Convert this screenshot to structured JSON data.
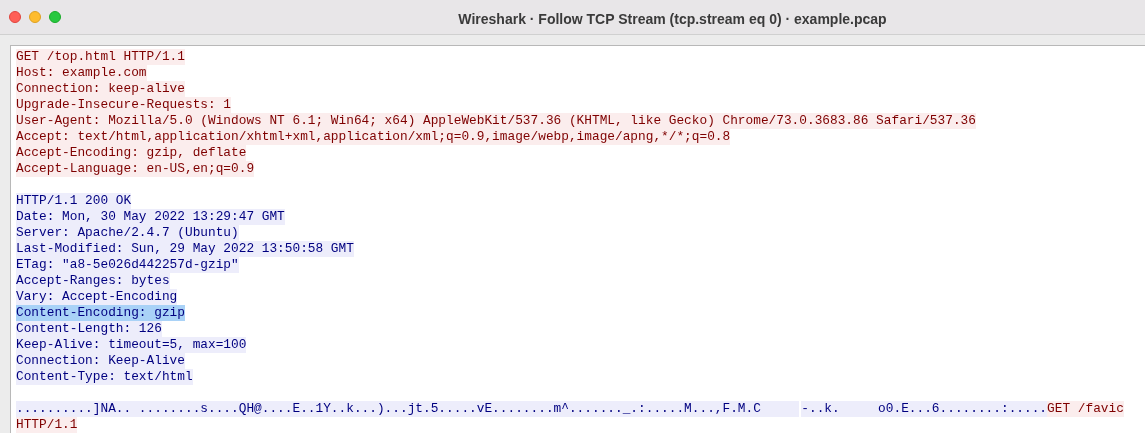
{
  "window": {
    "title": "Wireshark · Follow TCP Stream (tcp.stream eq 0) · example.pcap"
  },
  "blocks": [
    {
      "lines": [
        [
          {
            "text": "GET /top.html HTTP/1.1",
            "kind": "client",
            "selected": false
          }
        ],
        [
          {
            "text": "Host: example.com",
            "kind": "client",
            "selected": false
          }
        ],
        [
          {
            "text": "Connection: keep-alive",
            "kind": "client",
            "selected": false
          }
        ],
        [
          {
            "text": "Upgrade-Insecure-Requests: 1",
            "kind": "client",
            "selected": false
          }
        ],
        [
          {
            "text": "User-Agent: Mozilla/5.0 (Windows NT 6.1; Win64; x64) AppleWebKit/537.36 (KHTML, like Gecko) Chrome/73.0.3683.86 Safari/537.36",
            "kind": "client",
            "selected": false
          }
        ],
        [
          {
            "text": "Accept: text/html,application/xhtml+xml,application/xml;q=0.9,image/webp,image/apng,*/*;q=0.8",
            "kind": "client",
            "selected": false
          }
        ],
        [
          {
            "text": "Accept-Encoding: gzip, deflate",
            "kind": "client",
            "selected": false
          }
        ],
        [
          {
            "text": "Accept-Language: en-US,en;q=0.9",
            "kind": "client",
            "selected": false
          }
        ]
      ]
    },
    {
      "lines": [
        [
          {
            "text": "HTTP/1.1 200 OK",
            "kind": "server",
            "selected": false
          }
        ],
        [
          {
            "text": "Date: Mon, 30 May 2022 13:29:47 GMT",
            "kind": "server",
            "selected": false
          }
        ],
        [
          {
            "text": "Server: Apache/2.4.7 (Ubuntu)",
            "kind": "server",
            "selected": false
          }
        ],
        [
          {
            "text": "Last-Modified: Sun, 29 May 2022 13:50:58 GMT",
            "kind": "server",
            "selected": false
          }
        ],
        [
          {
            "text": "ETag: \"a8-5e026d442257d-gzip\"",
            "kind": "server",
            "selected": false
          }
        ],
        [
          {
            "text": "Accept-Ranges: bytes",
            "kind": "server",
            "selected": false
          }
        ],
        [
          {
            "text": "Vary: Accept-Encoding",
            "kind": "server",
            "selected": false
          }
        ],
        [
          {
            "text": "Content-Encoding: gzip",
            "kind": "server",
            "selected": true
          }
        ],
        [
          {
            "text": "Content-Length: 126",
            "kind": "server",
            "selected": false
          }
        ],
        [
          {
            "text": "Keep-Alive: timeout=5, max=100",
            "kind": "server",
            "selected": false
          }
        ],
        [
          {
            "text": "Connection: Keep-Alive",
            "kind": "server",
            "selected": false
          }
        ],
        [
          {
            "text": "Content-Type: text/html",
            "kind": "server",
            "selected": false
          }
        ]
      ]
    },
    {
      "lines": [
        [
          {
            "text": "..........]NA.. ........s....QH@....E..1Y..k...)...jt.5.....vE........m^......._.:.....M...,F.M.C     ",
            "kind": "server",
            "selected": false
          },
          {
            "text": "-..k.     o0.E...6........:.....",
            "kind": "server",
            "selected": false
          },
          {
            "text": "GET /favic",
            "kind": "client",
            "selected": false
          }
        ],
        [
          {
            "text": "HTTP/1.1",
            "kind": "client",
            "selected": false
          }
        ]
      ]
    }
  ]
}
